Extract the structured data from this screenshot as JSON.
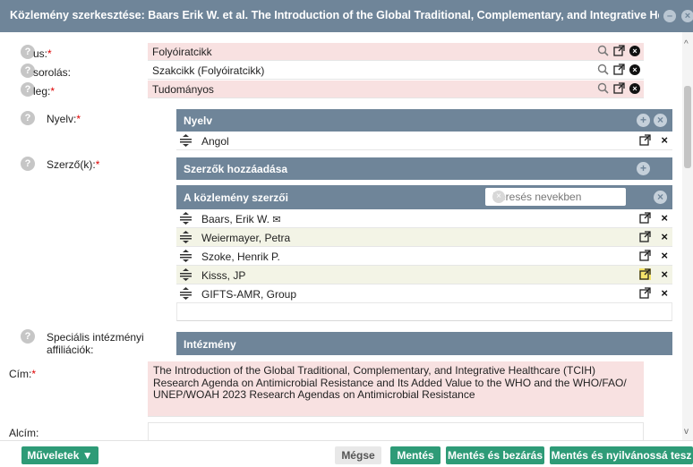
{
  "window": {
    "title": "Közlemény szerkesztése: Baars Erik W. et al. The Introduction of the Global Traditional, Complementary, and Integrative Hea..."
  },
  "fields": {
    "tipus": {
      "label": "us:",
      "value": "Folyóiratcikk"
    },
    "besorolas": {
      "label": "sorolás:",
      "value": "Szakcikk (Folyóiratcikk)"
    },
    "jelleg": {
      "label": "leg:",
      "value": "Tudományos"
    },
    "nyelv_label": "Nyelv:",
    "szerzok_label": "Szerző(k):",
    "specialis_label_1": "Speciális intézményi",
    "specialis_label_2": "affiliációk:",
    "cim_label": "Cím:",
    "alcim_label": "Alcím:",
    "required_mark": "*"
  },
  "nyelv_panel": {
    "title": "Nyelv",
    "items": [
      "Angol"
    ]
  },
  "szerzok_add_panel": {
    "title": "Szerzők hozzáadása"
  },
  "szerzok_panel": {
    "title": "A közlemény szerzői",
    "search_placeholder": "Keresés nevekben",
    "authors": [
      {
        "name": "Baars, Erik W.",
        "mail": "✉"
      },
      {
        "name": "Weiermayer, Petra"
      },
      {
        "name": "Szoke, Henrik P."
      },
      {
        "name": "Kisss, JP"
      },
      {
        "name": "GIFTS-AMR, Group"
      }
    ]
  },
  "intezmeny_panel": {
    "title": "Intézmény"
  },
  "cim": {
    "line1": "The Introduction of the Global Traditional, Complementary, and Integrative Healthcare (TCIH)",
    "line2": "Research Agenda on Antimicrobial Resistance and Its Added Value to the WHO and the WHO/FAO/",
    "line3": "UNEP/WOAH 2023 Research Agendas on Antimicrobial Resistance"
  },
  "footer": {
    "muveletek": "Műveletek ▼",
    "megse": "Mégse",
    "mentes": "Mentés",
    "mentes_bezaras": "Mentés és bezárás",
    "mentes_nyilvanos": "Mentés és nyilvánossá tesz"
  },
  "glyphs": {
    "help": "?",
    "close": "×",
    "plus": "+"
  },
  "colors": {
    "header": "#6f8599",
    "required": "#dd0000",
    "required_field": "#f8e1e1",
    "button_green": "#2e9b77"
  }
}
